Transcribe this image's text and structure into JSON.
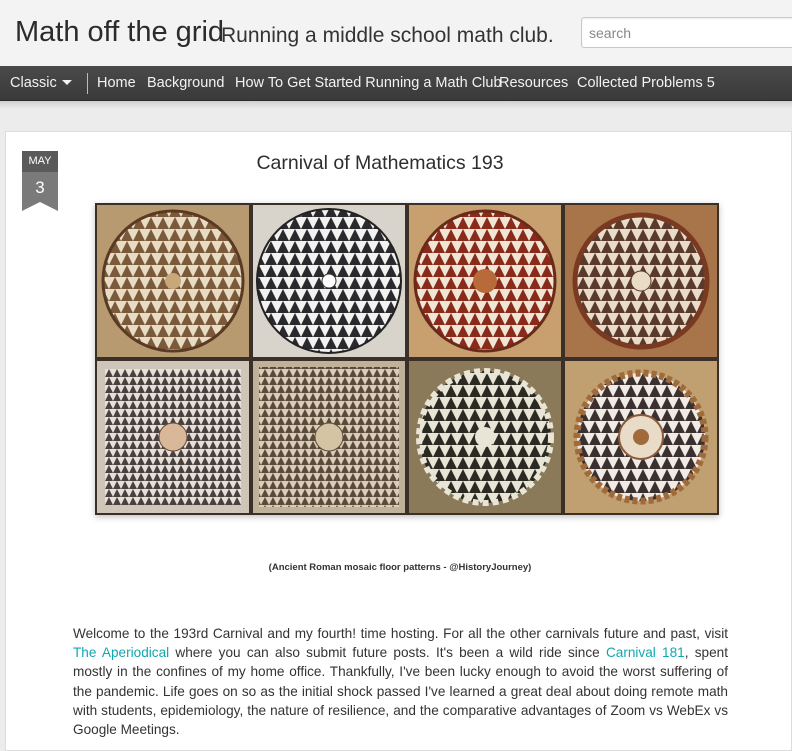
{
  "header": {
    "title": "Math off the grid",
    "description": "Running a middle school math club.",
    "search_placeholder": "search"
  },
  "nav": {
    "view_selector": "Classic",
    "items": [
      {
        "label": "Home"
      },
      {
        "label": "Background"
      },
      {
        "label": "How To Get Started Running a Math Club"
      },
      {
        "label": "Resources"
      },
      {
        "label": "Collected Problems 5"
      }
    ]
  },
  "post": {
    "date_month": "MAY",
    "date_day": "3",
    "title": "Carnival of Mathematics 193",
    "image_caption": "(Ancient Roman mosaic floor patterns - @HistoryJourney)",
    "body": {
      "p1_a": "Welcome to the 193rd Carnival and my fourth! time hosting. For all the other carnivals future and past, visit ",
      "link1": "The Aperiodical",
      "p1_b": " where you can also submit future posts. It's been a wild ride since ",
      "link2": "Carnival 181",
      "p1_c": ", spent mostly in the confines of my home office. Thankfully, I've been lucky enough to avoid the worst suffering of the pandemic. Life goes on so as the initial shock passed I've learned a great deal about doing remote math with students, epidemiology, the nature of resilience, and the comparative advantages of Zoom vs WebEx vs Google Meetings."
    }
  },
  "colors": {
    "link": "#10a8b0",
    "nav_bg": "#3f3f3f",
    "badge_bg": "#5a5a5a"
  }
}
